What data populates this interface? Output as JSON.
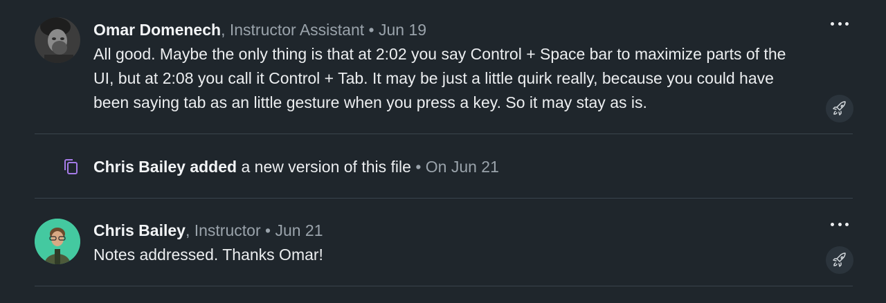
{
  "comments": [
    {
      "author": "Omar Domenech",
      "role": "Instructor Assistant",
      "date": "Jun 19",
      "body": "All good. Maybe the only thing is that at 2:02 you say Control + Space bar to maximize parts of the UI, but at 2:08 you call it Control + Tab. It may be just a little quirk really, because you could have been saying tab as an little gesture when you press a key. So it may stay as is.",
      "more_icon": "more-horizontal-icon",
      "reaction_icon": "rocket-icon"
    },
    {
      "author": "Chris Bailey",
      "role": "Instructor",
      "date": "Jun 21",
      "body": "Notes addressed. Thanks Omar!",
      "more_icon": "more-horizontal-icon",
      "reaction_icon": "rocket-icon"
    }
  ],
  "activity": {
    "icon": "file-versions-icon",
    "actor": "Chris Bailey",
    "action": "added",
    "object": "a new version of this file",
    "date": "On Jun 21",
    "icon_color": "#a57be8"
  },
  "separator": ",",
  "bullet": "•",
  "colors": {
    "background": "#1f262c",
    "divider": "#3a444d",
    "meta_text": "#9aa3ab",
    "primary_text": "#eceef0"
  }
}
